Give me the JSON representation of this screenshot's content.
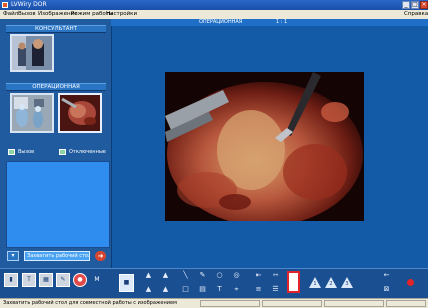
{
  "window": {
    "title": "LVWiry DOR"
  },
  "menu": {
    "file": "Файл",
    "call": "Вызов",
    "image": "Изображение",
    "workmode": "Режим работы",
    "settings": "Настройки",
    "help": "Справка"
  },
  "left": {
    "consultant_label": "КОНСУЛЬТАНТ",
    "operating_label": "ОПЕРАЦИОННАЯ",
    "call_button": "Вызов",
    "disabled_label": "Отключенные",
    "capture_button": "Захватить рабочий стол >>>"
  },
  "work": {
    "header_label": "ОПЕРАЦИОННАЯ",
    "zoom": "1 : 1"
  },
  "status": {
    "message": "Захватить рабочий стол для совместной работы с изображением"
  },
  "colors": {
    "panel": "#1f5b9e",
    "work": "#135ba6",
    "accent": "#e0242a"
  }
}
